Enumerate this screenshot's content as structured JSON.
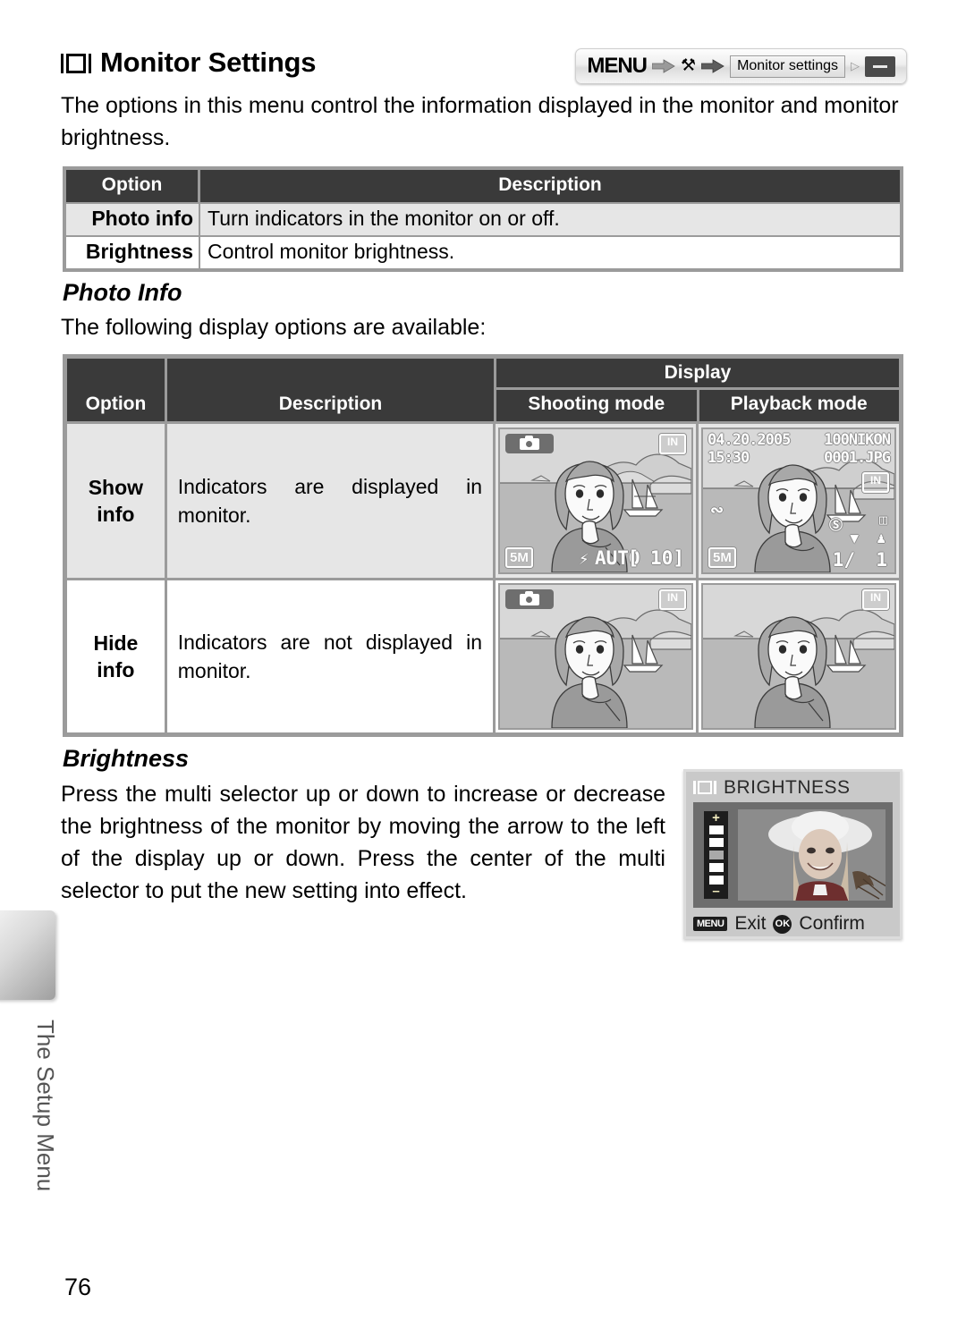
{
  "header": {
    "title": "Monitor Settings",
    "title_icon": "monitor-icon",
    "intro": "The options in this menu control the information displayed in the monitor and monitor brightness.",
    "breadcrumb": {
      "menu_label": "MENU",
      "wrench_icon": "wrench-icon",
      "arrow_icon": "right-arrow-icon",
      "field_value": "Monitor settings",
      "field_arrow": "▷",
      "dash_button": "—"
    }
  },
  "table_options": {
    "headers": [
      "Option",
      "Description"
    ],
    "rows": [
      {
        "option": "Photo info",
        "description": "Turn indicators in the monitor on or off."
      },
      {
        "option": "Brightness",
        "description": "Control monitor brightness."
      }
    ]
  },
  "photo_info": {
    "heading": "Photo Info",
    "intro": "The following display options are available:",
    "table": {
      "headers": {
        "option": "Option",
        "description": "Description",
        "display": "Display",
        "shooting": "Shooting mode",
        "playback": "Playback mode"
      },
      "rows": [
        {
          "option": "Show info",
          "option_line1": "Show",
          "option_line2": "info",
          "description": "Indicators are displayed in monitor.",
          "shooting_indicators": true,
          "playback_indicators": true
        },
        {
          "option": "Hide info",
          "option_line1": "Hide",
          "option_line2": "info",
          "description": "Indicators are not displayed in monitor.",
          "shooting_indicators": false,
          "playback_indicators": false
        }
      ]
    }
  },
  "camera_osd": {
    "shooting": {
      "mode_icon": "camera-mode-icon",
      "memory_badge": "IN",
      "image_size": "5M",
      "flash_mode": "AUTO",
      "flash_icon": "flash-icon",
      "shots_remaining": "10",
      "shots_bracket_left": "[",
      "shots_bracket_right": "]"
    },
    "playback": {
      "date": "04.20.2005",
      "time": "15:30",
      "folder": "100NIKON",
      "filename": "0001.JPG",
      "memory_badge": "IN",
      "image_size": "5M",
      "transfer_icon": "transfer-mark-icon",
      "ok_icon": "ok-button-icon",
      "print_icon": "print-icon",
      "delete_icon": "delete-icon",
      "voice_icon": "microphone-icon",
      "frame_current": "1/",
      "frame_total": "1"
    }
  },
  "brightness": {
    "heading": "Brightness",
    "body": "Press the multi selector up or down to increase or decrease the brightness of the monitor by moving the arrow to the left of the display up or down.  Press the center of the multi selector to put the new setting into effect.",
    "screen": {
      "monitor_icon": "monitor-icon",
      "title": "BRIGHTNESS",
      "scale_plus": "+",
      "scale_minus": "–",
      "scale_steps": 5,
      "scale_current_index": 2,
      "exit_button": "MENU",
      "exit_label": "Exit",
      "confirm_button": "OK",
      "confirm_label": "Confirm"
    }
  },
  "footer": {
    "side_label": "The Setup Menu",
    "page_number": "76"
  },
  "colors": {
    "header_dark": "#3a3a3a",
    "border_gray": "#9b9b9b",
    "row_shade": "#e6e6e6",
    "screen_gray": "#cfcfcf"
  }
}
